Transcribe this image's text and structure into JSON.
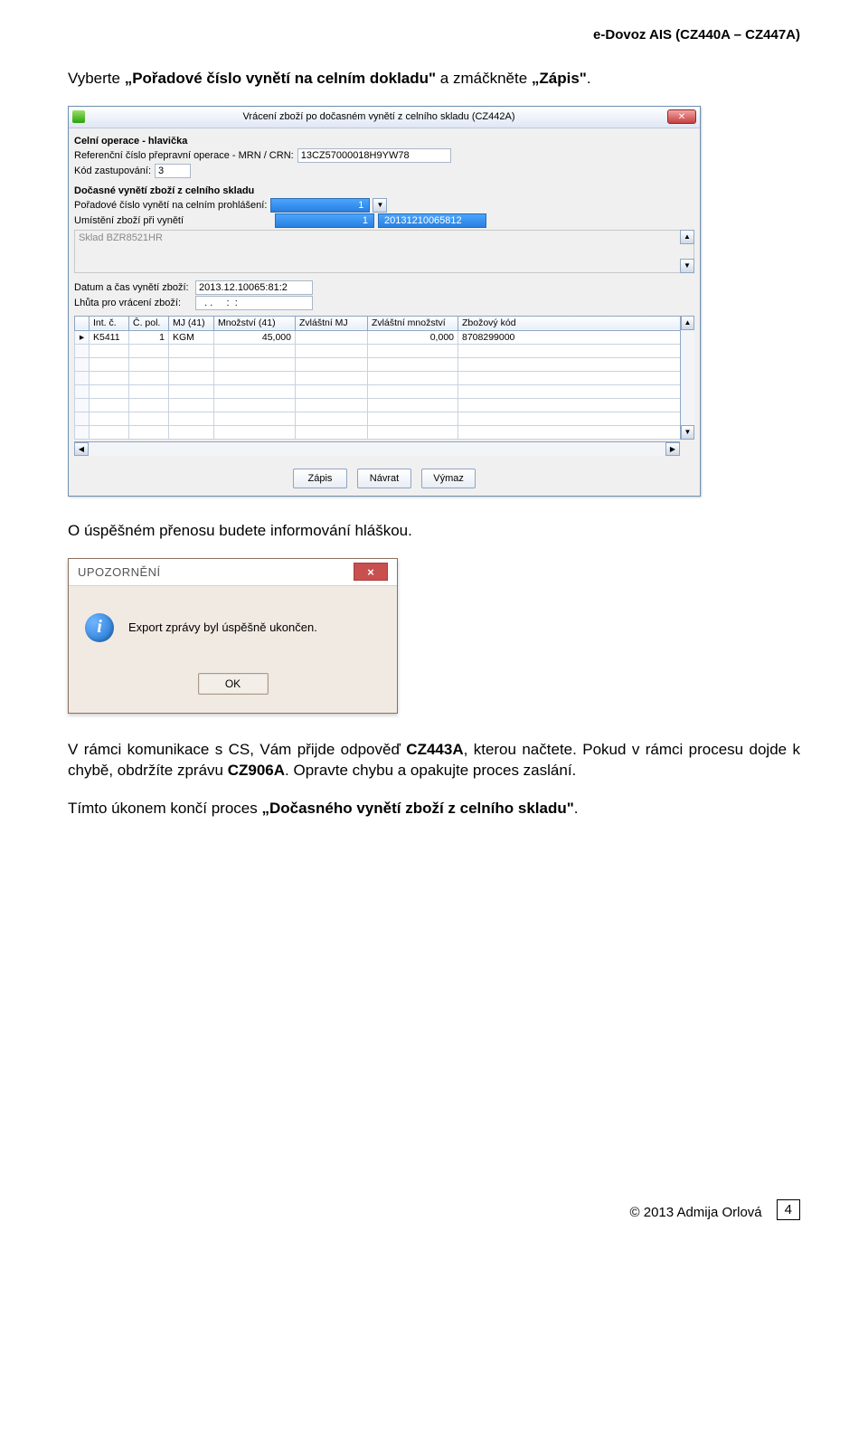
{
  "header": {
    "right": "e-Dovoz AIS (CZ440A – CZ447A)"
  },
  "para1": {
    "prefix": "Vyberte ",
    "bold1": "„Pořadové číslo vynětí na celním dokladu\"",
    "mid": " a zmáčkněte ",
    "bold2": "„Zápis\"",
    "suffix": "."
  },
  "win1": {
    "title": "Vrácení zboží po dočasném vynětí z celního skladu (CZ442A)",
    "section1": "Celní operace - hlavička",
    "ref_label": "Referenční číslo přepravní operace - MRN / CRN:",
    "ref_value": "13CZ57000018H9YW78",
    "kod_label": "Kód zastupování:",
    "kod_value": "3",
    "section2": "Dočasné vynětí zboží z celního skladu",
    "porad_label": "Pořadové číslo vynětí na celním prohlášení:",
    "porad_value": "1",
    "umist_label": "Umístění zboží při vynětí",
    "umist_num": "1",
    "umist_code": "20131210065812",
    "sklad": "Sklad BZR8521HR",
    "datum_label": "Datum a čas vynětí zboží:",
    "datum_value": "2013.12.10065:81:2",
    "lhuta_label": "Lhůta pro vrácení zboží:",
    "lhuta_value": "  . .     :  :",
    "grid": {
      "headers": [
        "",
        "Int. č.",
        "Č. pol.",
        "MJ (41)",
        "Množství (41)",
        "Zvláštní MJ",
        "Zvláštní množství",
        "Zbožový kód"
      ],
      "row": {
        "marker": "▸",
        "intc": "K5411",
        "cpol": "1",
        "mj": "KGM",
        "mnozstvi": "45,000",
        "zvlmj": "",
        "zvlmnoz": "0,000",
        "kod": "8708299000"
      }
    },
    "buttons": {
      "zapis": "Zápis",
      "navrat": "Návrat",
      "vymaz": "Výmaz"
    }
  },
  "para2": "O úspěšném přenosu budete informování hláškou.",
  "dialog": {
    "title": "UPOZORNĚNÍ",
    "message": "Export zprávy byl úspěšně ukončen.",
    "ok": "OK"
  },
  "para3": {
    "pre": "V rámci komunikace s CS, Vám přijde odpověď ",
    "b1": "CZ443A",
    "mid1": ", kterou načtete. Pokud v rámci procesu dojde k chybě, obdržíte zprávu ",
    "b2": "CZ906A",
    "post": ". Opravte chybu a opakujte proces zaslání."
  },
  "para4": {
    "pre": "Tímto úkonem končí proces ",
    "b": "„Dočasného vynětí zboží z celního skladu\"",
    "post": "."
  },
  "footer": {
    "copyright": "© 2013 Admija Orlová",
    "page": "4"
  }
}
